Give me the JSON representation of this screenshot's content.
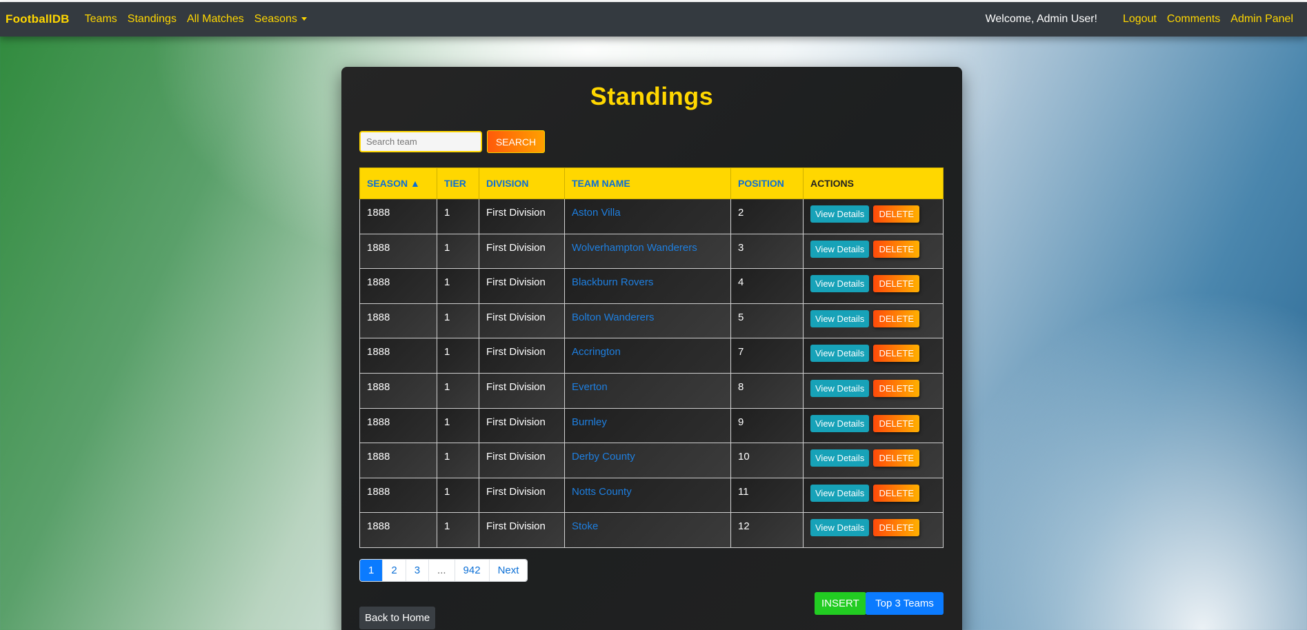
{
  "navbar": {
    "brand": "FootballDB",
    "links": [
      "Teams",
      "Standings",
      "All Matches"
    ],
    "seasons_label": "Seasons",
    "welcome": "Welcome, Admin User!",
    "logout": "Logout",
    "comments": "Comments",
    "admin_panel": "Admin Panel"
  },
  "page": {
    "title": "Standings"
  },
  "search": {
    "placeholder": "Search team",
    "button": "SEARCH"
  },
  "table": {
    "headers": [
      "SEASON ▲",
      "TIER",
      "DIVISION",
      "TEAM NAME",
      "POSITION",
      "ACTIONS"
    ],
    "view_label": "View Details",
    "delete_label": "DELETE",
    "rows": [
      {
        "season": "1888",
        "tier": "1",
        "division": "First Division",
        "team": "Aston Villa",
        "position": "2"
      },
      {
        "season": "1888",
        "tier": "1",
        "division": "First Division",
        "team": "Wolverhampton Wanderers",
        "position": "3"
      },
      {
        "season": "1888",
        "tier": "1",
        "division": "First Division",
        "team": "Blackburn Rovers",
        "position": "4"
      },
      {
        "season": "1888",
        "tier": "1",
        "division": "First Division",
        "team": "Bolton Wanderers",
        "position": "5"
      },
      {
        "season": "1888",
        "tier": "1",
        "division": "First Division",
        "team": "Accrington",
        "position": "7"
      },
      {
        "season": "1888",
        "tier": "1",
        "division": "First Division",
        "team": "Everton",
        "position": "8"
      },
      {
        "season": "1888",
        "tier": "1",
        "division": "First Division",
        "team": "Burnley",
        "position": "9"
      },
      {
        "season": "1888",
        "tier": "1",
        "division": "First Division",
        "team": "Derby County",
        "position": "10"
      },
      {
        "season": "1888",
        "tier": "1",
        "division": "First Division",
        "team": "Notts County",
        "position": "11"
      },
      {
        "season": "1888",
        "tier": "1",
        "division": "First Division",
        "team": "Stoke",
        "position": "12"
      }
    ]
  },
  "pagination": {
    "pages": [
      "1",
      "2",
      "3",
      "...",
      "942"
    ],
    "active": "1",
    "next": "Next"
  },
  "buttons": {
    "insert": "INSERT",
    "top3": "Top 3 Teams",
    "back": "Back to Home"
  },
  "colors": {
    "accent": "#ffd700",
    "link": "#1e7fe0",
    "navbar": "#343a40"
  }
}
